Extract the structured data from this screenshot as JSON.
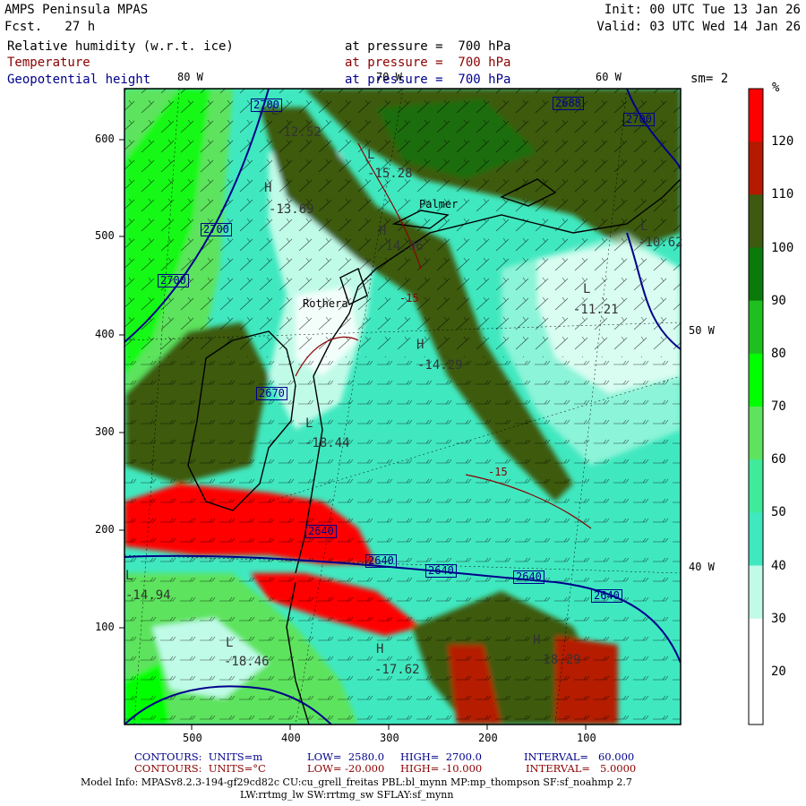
{
  "header": {
    "model": "AMPS Peninsula MPAS",
    "forecast": "Fcst.   27 h",
    "init": "Init: 00 UTC Tue 13 Jan 26",
    "valid": "Valid: 03 UTC Wed 14 Jan 26",
    "fields": [
      {
        "name": "Relative humidity (w.r.t. ice)",
        "level": "at pressure =  700 hPa",
        "color": "#000000"
      },
      {
        "name": "Temperature",
        "level": "at pressure =  700 hPa",
        "color": "#8b0000"
      },
      {
        "name": "Geopotential height",
        "level": "at pressure =  700 hPa",
        "color": "#00008b"
      }
    ],
    "smoothing": "sm= 2"
  },
  "colorbar": {
    "unit": "%",
    "labels": [
      "120",
      "110",
      "100",
      "90",
      "80",
      "70",
      "60",
      "50",
      "40",
      "30",
      "20"
    ],
    "bands": [
      {
        "from": 120,
        "to": 130,
        "color": "#ff0000"
      },
      {
        "from": 110,
        "to": 120,
        "color": "#b51a00"
      },
      {
        "from": 100,
        "to": 110,
        "color": "#3d5a10"
      },
      {
        "from": 90,
        "to": 100,
        "color": "#0a7a0a"
      },
      {
        "from": 80,
        "to": 90,
        "color": "#1fbf1f"
      },
      {
        "from": 70,
        "to": 80,
        "color": "#00ff00"
      },
      {
        "from": 60,
        "to": 70,
        "color": "#5de35d"
      },
      {
        "from": 50,
        "to": 60,
        "color": "#3fea9a"
      },
      {
        "from": 40,
        "to": 50,
        "color": "#40e8c0"
      },
      {
        "from": 30,
        "to": 40,
        "color": "#c0fbe8"
      },
      {
        "from": 20,
        "to": 30,
        "color": "#ffffff"
      },
      {
        "from": 10,
        "to": 20,
        "color": "#ffffff"
      }
    ]
  },
  "axes": {
    "x_ticks": [
      "500",
      "400",
      "300",
      "200",
      "100"
    ],
    "y_ticks": [
      "600",
      "500",
      "400",
      "300",
      "200",
      "100"
    ]
  },
  "grid_labels": [
    "80 W",
    "70 W",
    "60 W",
    "50 W",
    "40 W"
  ],
  "places": [
    "Palmer",
    "Rothera"
  ],
  "height_labels": [
    "2700",
    "2700",
    "2700",
    "2688",
    "2700",
    "2670",
    "2640",
    "2640",
    "2640",
    "2640",
    "2640"
  ],
  "temperature_labels": [
    "-15",
    "-15"
  ],
  "extrema": [
    {
      "mark": "H",
      "value": "-13.69"
    },
    {
      "mark": "H",
      "value": "-14.29"
    },
    {
      "mark": "L",
      "value": "-11.21"
    },
    {
      "mark": "L",
      "value": "-18.44"
    },
    {
      "mark": "L",
      "value": "-14.94"
    },
    {
      "mark": "L",
      "value": "-18.46"
    },
    {
      "mark": "H",
      "value": "-18.29"
    },
    {
      "mark": "L",
      "value": "-15.28"
    },
    {
      "mark": "L",
      "value": "-12.52"
    },
    {
      "mark": "H",
      "value": "-17.62"
    },
    {
      "mark": "H",
      "value": "-14.96"
    },
    {
      "mark": "L",
      "value": "-10.62"
    }
  ],
  "footer": {
    "line1": {
      "label": "CONTOURS:  UNITS=m",
      "low": "LOW=  2580.0",
      "high": "HIGH=  2700.0",
      "interval": "INTERVAL=   60.000"
    },
    "line2": {
      "label": "CONTOURS:  UNITS=°C",
      "low": "LOW= -20.000",
      "high": "HIGH= -10.000",
      "interval": "INTERVAL=   5.0000"
    },
    "model_info": "Model Info: MPASv8.2.3-194-gf29cd82c CU:cu_grell_freitas PBL:bl_mynn MP:mp_thompson SF:sf_noahmp 2.7",
    "model_info2": "LW:rrtmg_lw SW:rrtmg_sw SFLAY:sf_mynn"
  }
}
